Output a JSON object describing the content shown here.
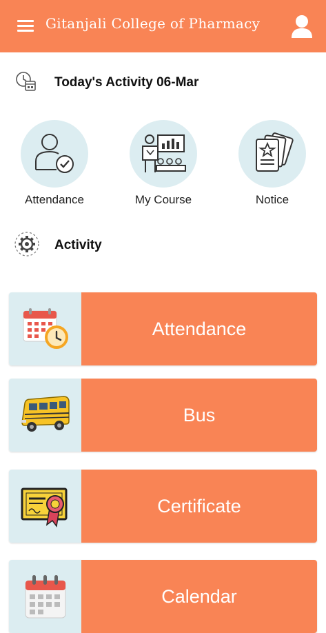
{
  "header": {
    "title": "Gitanjali College of Pharmacy",
    "menu_icon": "hamburger-menu-icon",
    "profile_icon": "user-profile-icon",
    "bg_color": "#F98455"
  },
  "today": {
    "heading": "Today's Activity 06-Mar",
    "icon": "clock-calendar-icon"
  },
  "quick_actions": [
    {
      "label": "Attendance",
      "icon": "person-check-icon"
    },
    {
      "label": "My Course",
      "icon": "classroom-presentation-icon"
    },
    {
      "label": "Notice",
      "icon": "notice-cards-icon"
    }
  ],
  "activity": {
    "heading": "Activity",
    "icon": "gear-icon"
  },
  "activity_items": [
    {
      "label": "Attendance",
      "icon": "calendar-clock-icon"
    },
    {
      "label": "Bus",
      "icon": "school-bus-icon"
    },
    {
      "label": "Certificate",
      "icon": "certificate-icon"
    },
    {
      "label": "Calendar",
      "icon": "calendar-icon"
    }
  ],
  "colors": {
    "accent": "#F98455",
    "tile_bg": "#DCEDF1"
  }
}
